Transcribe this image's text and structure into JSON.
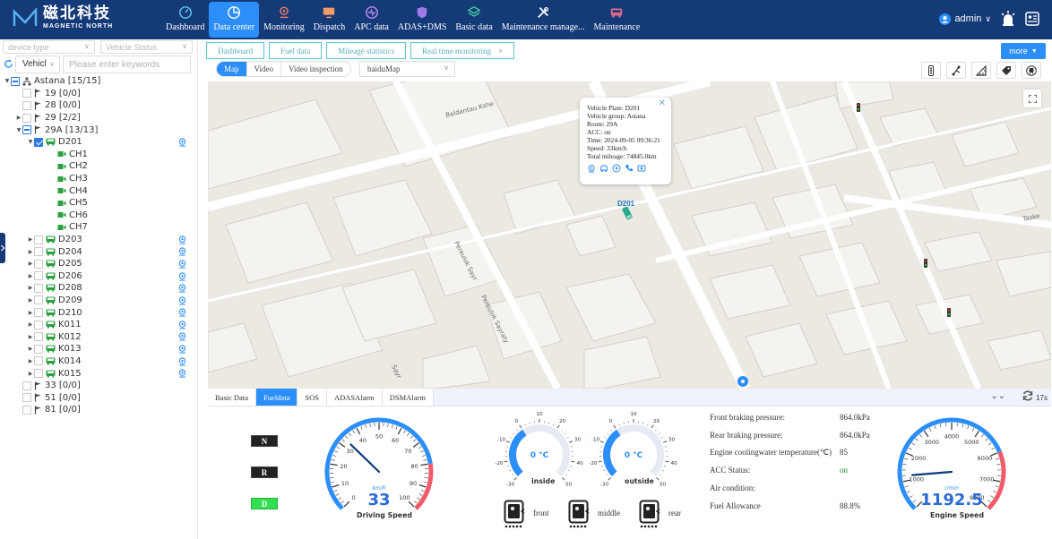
{
  "brand": {
    "name_cn": "磁北科技",
    "name_en": "MAGNETIC NORTH"
  },
  "nav": [
    {
      "label": "Dashboard",
      "icon": "dashboard-icon",
      "active": false
    },
    {
      "label": "Data center",
      "icon": "pie-chart-icon",
      "active": true
    },
    {
      "label": "Monitoring",
      "icon": "location-pin-icon",
      "active": false
    },
    {
      "label": "Dispatch",
      "icon": "monitor-icon",
      "active": false
    },
    {
      "label": "APC data",
      "icon": "pulse-icon",
      "active": false
    },
    {
      "label": "ADAS+DMS",
      "icon": "shield-icon",
      "active": false
    },
    {
      "label": "Basic data",
      "icon": "layers-icon",
      "active": false
    },
    {
      "label": "Maintenance manage...",
      "icon": "wrench-icon",
      "active": false
    },
    {
      "label": "Maintenance",
      "icon": "bus-icon",
      "active": false
    }
  ],
  "user": {
    "name": "admin"
  },
  "left": {
    "device_type_placeholder": "device type",
    "vehicle_status_placeholder": "Vehicle Status",
    "search_type": "Vehicl",
    "search_placeholder": "Please enter keywords"
  },
  "tree": [
    {
      "label": "Astana [15/15]",
      "level": 0,
      "arrow": "down",
      "check": "half",
      "icon": "org"
    },
    {
      "label": "19 [0/0]",
      "level": 1,
      "arrow": "",
      "check": "off",
      "icon": "flag"
    },
    {
      "label": "28 [0/0]",
      "level": 1,
      "arrow": "",
      "check": "off",
      "icon": "flag"
    },
    {
      "label": "29 [2/2]",
      "level": 1,
      "arrow": "right",
      "check": "off",
      "icon": "flag"
    },
    {
      "label": "29A [13/13]",
      "level": 1,
      "arrow": "down",
      "check": "half",
      "icon": "flag"
    },
    {
      "label": "D201",
      "level": 2,
      "arrow": "down",
      "check": "on",
      "icon": "bus",
      "loc": true
    },
    {
      "label": "CH1",
      "level": 3,
      "arrow": "",
      "check": "",
      "icon": "cam"
    },
    {
      "label": "CH2",
      "level": 3,
      "arrow": "",
      "check": "",
      "icon": "cam"
    },
    {
      "label": "CH3",
      "level": 3,
      "arrow": "",
      "check": "",
      "icon": "cam"
    },
    {
      "label": "CH4",
      "level": 3,
      "arrow": "",
      "check": "",
      "icon": "cam"
    },
    {
      "label": "CH5",
      "level": 3,
      "arrow": "",
      "check": "",
      "icon": "cam"
    },
    {
      "label": "CH6",
      "level": 3,
      "arrow": "",
      "check": "",
      "icon": "cam"
    },
    {
      "label": "CH7",
      "level": 3,
      "arrow": "",
      "check": "",
      "icon": "cam"
    },
    {
      "label": "D203",
      "level": 2,
      "arrow": "right",
      "check": "off",
      "icon": "bus",
      "loc": true
    },
    {
      "label": "D204",
      "level": 2,
      "arrow": "right",
      "check": "off",
      "icon": "bus",
      "loc": true
    },
    {
      "label": "D205",
      "level": 2,
      "arrow": "right",
      "check": "off",
      "icon": "bus",
      "loc": true
    },
    {
      "label": "D206",
      "level": 2,
      "arrow": "right",
      "check": "off",
      "icon": "bus",
      "loc": true
    },
    {
      "label": "D208",
      "level": 2,
      "arrow": "right",
      "check": "off",
      "icon": "bus",
      "loc": true
    },
    {
      "label": "D209",
      "level": 2,
      "arrow": "right",
      "check": "off",
      "icon": "bus",
      "loc": true
    },
    {
      "label": "D210",
      "level": 2,
      "arrow": "right",
      "check": "off",
      "icon": "bus",
      "loc": true
    },
    {
      "label": "K011",
      "level": 2,
      "arrow": "right",
      "check": "off",
      "icon": "bus",
      "loc": true
    },
    {
      "label": "K012",
      "level": 2,
      "arrow": "right",
      "check": "off",
      "icon": "bus",
      "loc": true
    },
    {
      "label": "K013",
      "level": 2,
      "arrow": "right",
      "check": "off",
      "icon": "bus",
      "loc": true
    },
    {
      "label": "K014",
      "level": 2,
      "arrow": "right",
      "check": "off",
      "icon": "bus",
      "loc": true
    },
    {
      "label": "K015",
      "level": 2,
      "arrow": "right",
      "check": "off",
      "icon": "bus",
      "loc": true
    },
    {
      "label": "33 [0/0]",
      "level": 1,
      "arrow": "",
      "check": "off",
      "icon": "flag"
    },
    {
      "label": "51 [0/0]",
      "level": 1,
      "arrow": "",
      "check": "off",
      "icon": "flag"
    },
    {
      "label": "81 [0/0]",
      "level": 1,
      "arrow": "",
      "check": "off",
      "icon": "flag"
    }
  ],
  "tabs": [
    {
      "label": "Dashboard",
      "closable": false
    },
    {
      "label": "Fuel data",
      "closable": false
    },
    {
      "label": "Mileage statistics",
      "closable": false
    },
    {
      "label": "Real time monitoring",
      "closable": true
    }
  ],
  "more_label": "more",
  "subtabs": [
    {
      "label": "Map",
      "active": true
    },
    {
      "label": "Video",
      "active": false
    },
    {
      "label": "Video inspection",
      "active": false
    }
  ],
  "map_provider": "baiduMap",
  "map": {
    "streets": [
      "Baldantau Kshe",
      "Pereulok Sayr",
      "Pereulok Sayraty",
      "Sayr",
      "Taske"
    ],
    "vehicle_label": "D201"
  },
  "popup": {
    "lines": [
      "Vehicle Plate:  D201",
      "Vehicle group:  Astana",
      "Route:  29A",
      "ACC:  on",
      "Time:  2024-09-05 09:36:21",
      "Speed:  33km/h",
      "Total mileage:  74845.0km"
    ]
  },
  "bottom_tabs": [
    {
      "label": "Basic Data",
      "active": false
    },
    {
      "label": "Fueldata",
      "active": true
    },
    {
      "label": "SOS",
      "active": false
    },
    {
      "label": "ADASAlarm",
      "active": false
    },
    {
      "label": "DSMAlarm",
      "active": false
    }
  ],
  "refresh_label": "17s",
  "gears": [
    {
      "label": "N",
      "active": false
    },
    {
      "label": "R",
      "active": false
    },
    {
      "label": "D",
      "active": true
    }
  ],
  "speed_gauge": {
    "value": "33",
    "unit": "km/h",
    "title": "Driving Speed",
    "min": 0,
    "max": 100,
    "current": 33,
    "red_from": 80,
    "ticks": [
      "0",
      "10",
      "20",
      "30",
      "40",
      "50",
      "60",
      "70",
      "80",
      "90",
      "100"
    ]
  },
  "temp_inside": {
    "value": "0 °C",
    "label": "inside",
    "ticks": [
      "-30",
      "-20",
      "-10",
      "0",
      "10",
      "20",
      "30",
      "40",
      "50"
    ]
  },
  "temp_outside": {
    "value": "0 °C",
    "label": "outside",
    "ticks": [
      "-30",
      "-20",
      "-10",
      "0",
      "10",
      "20",
      "30",
      "40",
      "50"
    ]
  },
  "doors": [
    {
      "label": "front"
    },
    {
      "label": "middle"
    },
    {
      "label": "rear"
    }
  ],
  "info": [
    {
      "label": "Front braking pressure:",
      "value": "864.0kPa"
    },
    {
      "label": "Rear braking pressure:",
      "value": "864.0kPa"
    },
    {
      "label": "Engine coolingwater temperature(℃)",
      "value": "85"
    },
    {
      "label": "ACC Status:",
      "value": "on",
      "color": "#1a8c1a"
    },
    {
      "label": "Air condition:",
      "value": ""
    },
    {
      "label": "Fuel Allowance",
      "value": "88.8%"
    }
  ],
  "engine_gauge": {
    "value": "1192.5",
    "unit": "r/min",
    "title": "Engine Speed",
    "min": 0,
    "max": 8000,
    "current": 1192.5,
    "red_from": 6000,
    "ticks": [
      "0",
      "1000",
      "2000",
      "3000",
      "4000",
      "5000",
      "6000",
      "7000",
      "8000"
    ]
  },
  "colors": {
    "header": "#143a78",
    "accent": "#2c8ef8",
    "gauge_blue": "#2c8ef8",
    "gauge_red": "#f05a6a",
    "gear_on": "#30e050"
  }
}
